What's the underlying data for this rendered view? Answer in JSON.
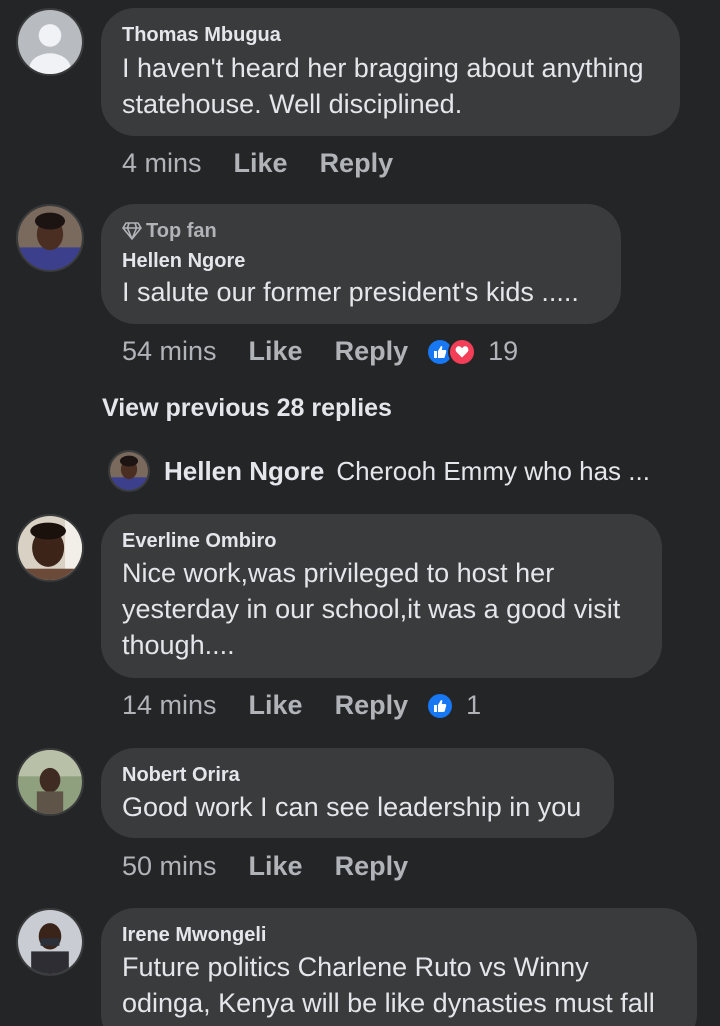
{
  "comments": [
    {
      "author": "Thomas Mbugua",
      "lines": [
        "I haven't heard her bragging about anything",
        "statehouse. Well disciplined."
      ],
      "time": "4 mins",
      "like_label": "Like",
      "reply_label": "Reply"
    },
    {
      "badge": "Top fan",
      "author": "Hellen Ngore",
      "lines": [
        "I salute our former president's kids ....."
      ],
      "time": "54 mins",
      "like_label": "Like",
      "reply_label": "Reply",
      "reaction_count": "19"
    },
    {
      "author": "Everline Ombiro",
      "lines": [
        "Nice work,was privileged to host her",
        "yesterday in our school,it was a good visit",
        "though...."
      ],
      "time": "14 mins",
      "like_label": "Like",
      "reply_label": "Reply",
      "reaction_count": "1"
    },
    {
      "author": "Nobert Orira",
      "lines": [
        "Good work I can see leadership in you"
      ],
      "time": "50 mins",
      "like_label": "Like",
      "reply_label": "Reply"
    },
    {
      "author": "Irene Mwongeli",
      "lines": [
        "Future politics Charlene Ruto vs Winny",
        "odinga, Kenya will be like dynasties must fall"
      ]
    }
  ],
  "view_previous_label": "View previous 28 replies",
  "reply_preview": {
    "name": "Hellen Ngore",
    "text": "Cherooh Emmy who has ..."
  },
  "colors": {
    "background": "#242526",
    "bubble": "#3a3b3c",
    "primary_text": "#e4e6eb",
    "secondary_text": "#b0b3b8",
    "like_blue": "#1877f2",
    "love_red": "#f33e58"
  }
}
